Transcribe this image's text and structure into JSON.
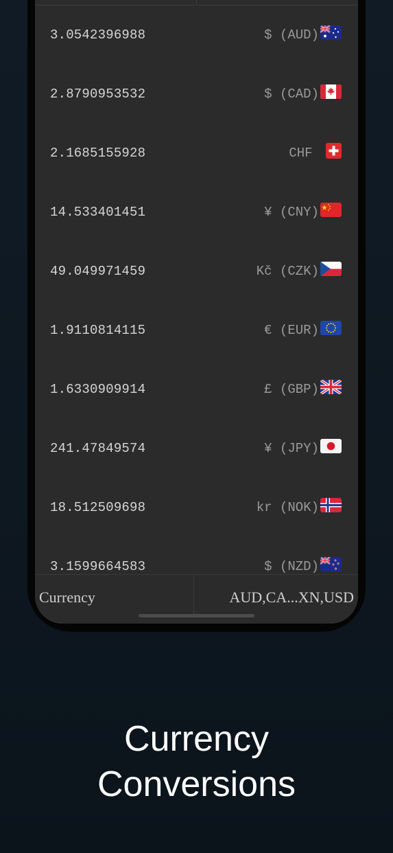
{
  "rates": [
    {
      "value": "3.0542396988",
      "code": "$ (AUD)",
      "flag_icon": "australia-flag-icon"
    },
    {
      "value": "2.8790953532",
      "code": "$ (CAD)",
      "flag_icon": "canada-flag-icon"
    },
    {
      "value": "2.1685155928",
      "code": "CHF",
      "flag_icon": "switzerland-flag-icon"
    },
    {
      "value": "14.533401451",
      "code": "¥ (CNY)",
      "flag_icon": "china-flag-icon"
    },
    {
      "value": "49.049971459",
      "code": "Kč (CZK)",
      "flag_icon": "czech-flag-icon"
    },
    {
      "value": "1.9110814115",
      "code": "€ (EUR)",
      "flag_icon": "eu-flag-icon"
    },
    {
      "value": "1.6330909914",
      "code": "£ (GBP)",
      "flag_icon": "uk-flag-icon"
    },
    {
      "value": "241.47849574",
      "code": "¥ (JPY)",
      "flag_icon": "japan-flag-icon"
    },
    {
      "value": "18.512509698",
      "code": "kr (NOK)",
      "flag_icon": "norway-flag-icon"
    },
    {
      "value": "3.1599664583",
      "code": "$ (NZD)",
      "flag_icon": "new-zealand-flag-icon"
    }
  ],
  "bottom_bar": {
    "label": "Currency",
    "value": "AUD,CA...XN,USD"
  },
  "caption": {
    "line1": "Currency",
    "line2": "Conversions"
  },
  "colors": {
    "background": "#0e1821",
    "screen": "#2b2b2b",
    "text_primary": "#d6d6d6",
    "text_secondary": "#9a9a9a"
  }
}
